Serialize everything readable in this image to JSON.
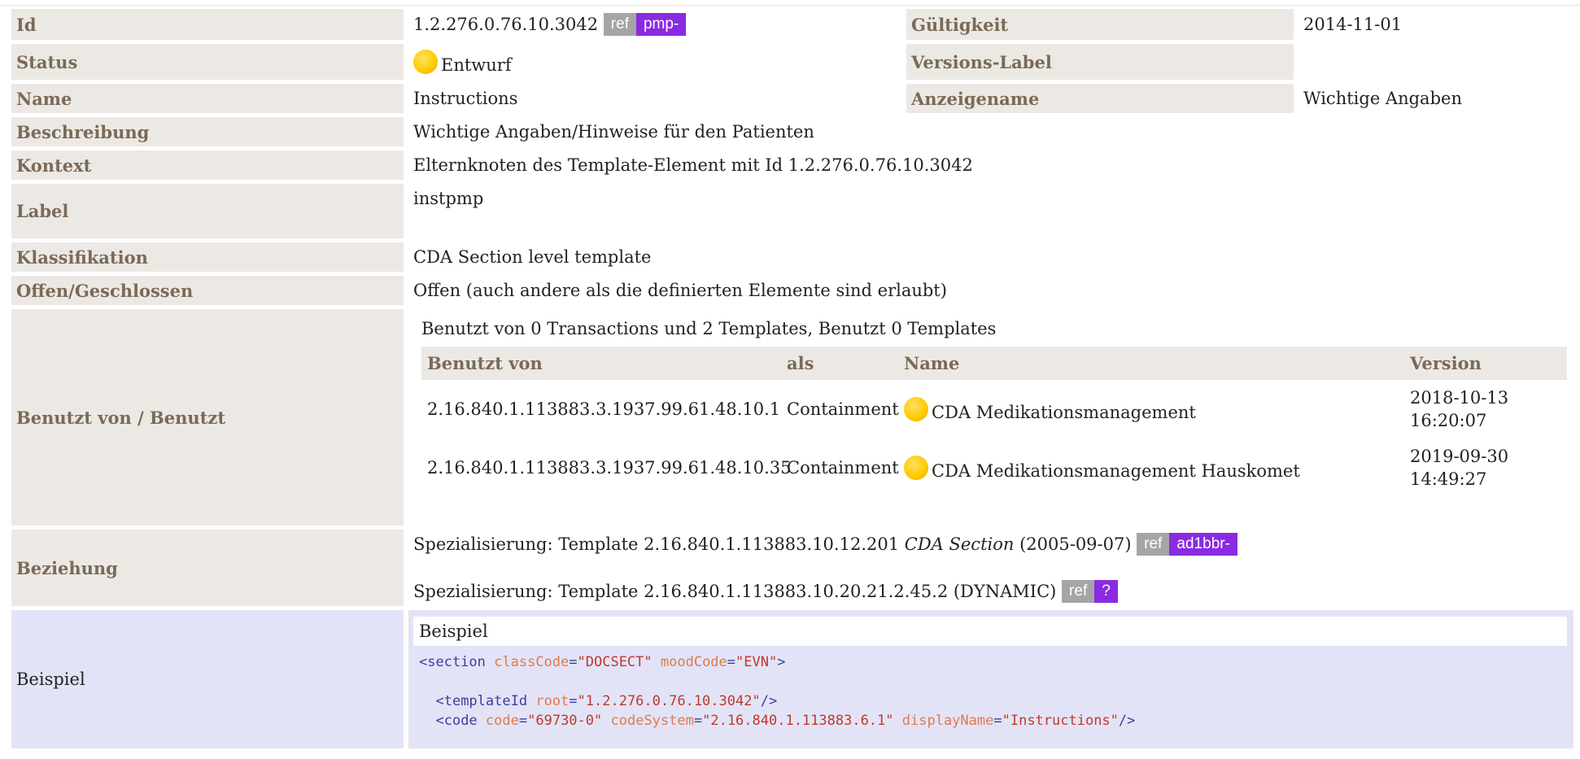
{
  "id": {
    "label": "Id",
    "value": "1.2.276.0.76.10.3042",
    "ref": "ref",
    "prefix": "pmp-"
  },
  "validity": {
    "label": "Gültigkeit",
    "value": "2014-11-01"
  },
  "status": {
    "label": "Status",
    "value": "Entwurf"
  },
  "version_label": {
    "label": "Versions-Label",
    "value": ""
  },
  "name": {
    "label": "Name",
    "value": "Instructions"
  },
  "display_name": {
    "label": "Anzeigename",
    "value": "Wichtige Angaben"
  },
  "description": {
    "label": "Beschreibung",
    "value": "Wichtige Angaben/Hinweise für den Patienten"
  },
  "context": {
    "label": "Kontext",
    "value": "Elternknoten des Template-Element mit Id 1.2.276.0.76.10.3042"
  },
  "label": {
    "label": "Label",
    "value": "instpmp"
  },
  "classification": {
    "label": "Klassifikation",
    "value": "CDA Section level template"
  },
  "open_closed": {
    "label": "Offen/Geschlossen",
    "value": "Offen (auch andere als die definierten Elemente sind erlaubt)"
  },
  "usage": {
    "label": "Benutzt von / Benutzt",
    "summary": "Benutzt von 0 Transactions und 2 Templates, Benutzt 0 Templates",
    "headers": {
      "used_by": "Benutzt von",
      "as": "als",
      "name": "Name",
      "version": "Version"
    },
    "rows": [
      {
        "id": "2.16.840.1.113883.3.1937.99.61.48.10.1",
        "as": "Containment",
        "name": "CDA Medikationsmanagement",
        "version_date": "2018-10-13",
        "version_time": "16:20:07"
      },
      {
        "id": "2.16.840.1.113883.3.1937.99.61.48.10.35",
        "as": "Containment",
        "name": "CDA Medikationsmanagement Hauskomet",
        "version_date": "2019-09-30",
        "version_time": "14:49:27"
      }
    ]
  },
  "relationship": {
    "label": "Beziehung",
    "line1": {
      "prefix": "Spezialisierung: Template 2.16.840.1.113883.10.12.201 ",
      "italic": "CDA Section",
      "suffix": " (2005-09-07)",
      "ref": "ref",
      "badge": "ad1bbr-"
    },
    "line2": {
      "text": "Spezialisierung: Template 2.16.840.1.113883.10.20.21.2.45.2 (DYNAMIC)",
      "ref": "ref",
      "badge": "?"
    }
  },
  "example": {
    "label": "Beispiel",
    "title": "Beispiel",
    "code": {
      "l1_open": "<section",
      "l1_a1": "classCode",
      "l1_v1": "\"DOCSECT\"",
      "l1_a2": "moodCode",
      "l1_v2": "\"EVN\"",
      "l1_close": ">",
      "l2_open": "<templateId",
      "l2_a1": "root",
      "l2_v1": "\"1.2.276.0.76.10.3042\"",
      "l2_close": "/>",
      "l3_open": "<code",
      "l3_a1": "code",
      "l3_v1": "\"69730-0\"",
      "l3_a2": "codeSystem",
      "l3_v2": "\"2.16.840.1.113883.6.1\"",
      "l3_a3": "displayName",
      "l3_v3": "\"Instructions\"",
      "l3_close": "/>"
    }
  },
  "colors": {
    "label_bg": "#ece9e4",
    "label_text": "#7a6a58",
    "badge_purple": "#8a2be2",
    "badge_gray": "#a5a5a5",
    "example_bg": "#e3e3f7"
  }
}
